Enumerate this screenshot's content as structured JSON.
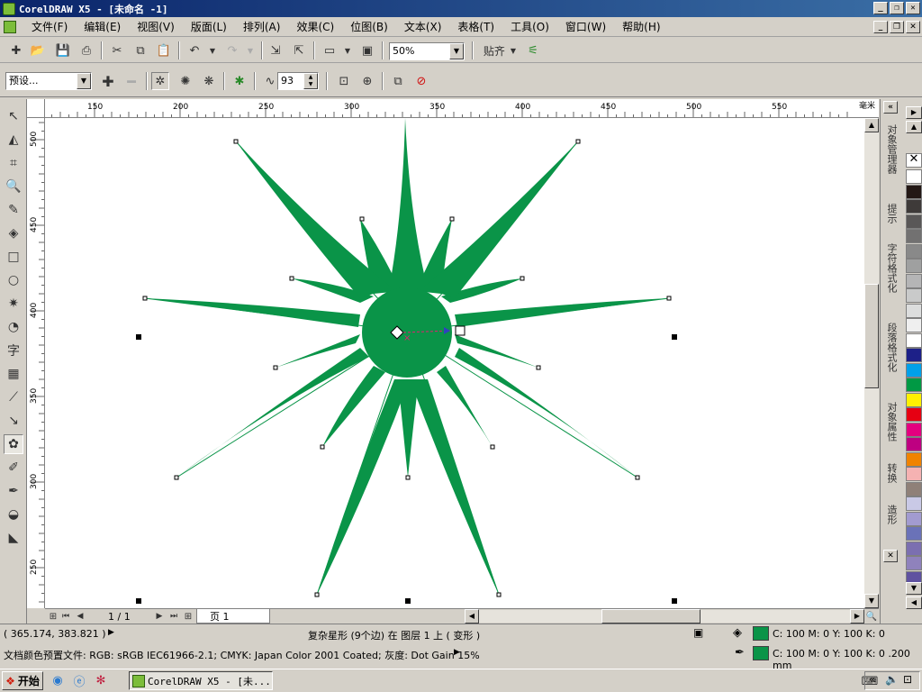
{
  "window": {
    "title": "CorelDRAW X5 - [未命名 -1]"
  },
  "menu": [
    "文件(F)",
    "编辑(E)",
    "视图(V)",
    "版面(L)",
    "排列(A)",
    "效果(C)",
    "位图(B)",
    "文本(X)",
    "表格(T)",
    "工具(O)",
    "窗口(W)",
    "帮助(H)"
  ],
  "standard_toolbar": {
    "zoom_value": "50%",
    "snap_label": "贴齐"
  },
  "property_bar": {
    "preset_value": "预设...",
    "sharpness_value": "93"
  },
  "ruler": {
    "unit": "毫米",
    "h_ticks": [
      150,
      200,
      250,
      300,
      350,
      400,
      450,
      500,
      550
    ],
    "v_ticks": [
      500,
      450,
      400,
      350,
      300,
      250
    ]
  },
  "page_nav": {
    "counter": "1 / 1",
    "tab_label": "页 1"
  },
  "status": {
    "coords": "( 365.174, 383.821 )",
    "object_info": "复杂星形 (9个边) 在 图层 1 上 ( 变形 )",
    "color_profile": "文档颜色预置文件: RGB: sRGB IEC61966-2.1; CMYK: Japan Color 2001 Coated; 灰度: Dot Gain 15%",
    "fill_text": "C: 100 M: 0 Y: 100 K: 0",
    "outline_text": "C: 100 M: 0 Y: 100 K: 0  .200 mm",
    "fill_color": "#0a9448"
  },
  "dockers": [
    "对象管理器",
    "提示",
    "字符格式化",
    "段落格式化",
    "对象属性",
    "转换",
    "造形"
  ],
  "palette": [
    "#ffffff",
    "#231815",
    "#3e3a39",
    "#595757",
    "#727171",
    "#898989",
    "#9fa0a0",
    "#b5b5b6",
    "#c9caca",
    "#dcdddd",
    "#efefef",
    "#ffffff",
    "#1d2088",
    "#00a0e9",
    "#009944",
    "#fff100",
    "#e60012",
    "#e4007f",
    "#be0081",
    "#f08300",
    "#f5b2b2",
    "#8f8078",
    "#c9c9e6",
    "#a29bd0",
    "#6a72b8",
    "#7b6fb0",
    "#8f82bc",
    "#5f52a0"
  ],
  "taskbar": {
    "start_label": "开始",
    "task_label": "CorelDRAW X5 - [未..."
  }
}
